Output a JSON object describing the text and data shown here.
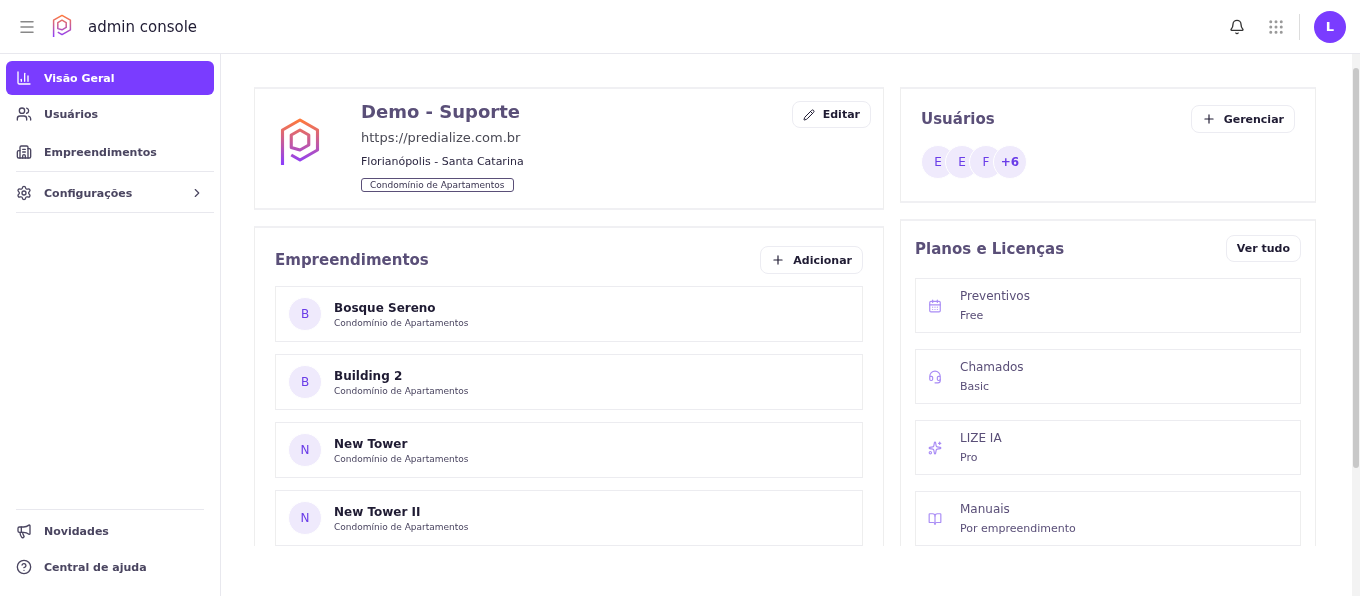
{
  "header": {
    "title": "admin console",
    "avatar": "L"
  },
  "sidebar": {
    "items": [
      {
        "label": "Visão Geral",
        "selected": true
      },
      {
        "label": "Usuários",
        "selected": false
      },
      {
        "label": "Empreendimentos",
        "selected": false
      },
      {
        "label": "Configurações",
        "selected": false,
        "kind": "expandable"
      }
    ],
    "footer": [
      {
        "label": "Novidades"
      },
      {
        "label": "Central de ajuda"
      }
    ]
  },
  "profile": {
    "name": "Demo - Suporte",
    "url": "https://predialize.com.br",
    "location": "Florianópolis - Santa Catarina",
    "tag": "Condomínio de Apartamentos",
    "button": "Editar"
  },
  "developments": {
    "title": "Empreendimentos",
    "button": "Adicionar",
    "rows": [
      {
        "initial": "B",
        "name": "Bosque Sereno",
        "type": "Condomínio de Apartamentos"
      },
      {
        "initial": "B",
        "name": "Building 2",
        "type": "Condomínio de Apartamentos"
      },
      {
        "initial": "N",
        "name": "New Tower",
        "type": "Condomínio de Apartamentos"
      },
      {
        "initial": "N",
        "name": "New Tower II",
        "type": "Condomínio de Apartamentos"
      }
    ]
  },
  "users": {
    "title": "Usuários",
    "button": "Gerenciar",
    "avatars": [
      "E",
      "E",
      "F",
      "+6"
    ]
  },
  "plans": {
    "title": "Planos e Licenças",
    "button": "Ver tudo",
    "rows": [
      {
        "name": "Preventivos",
        "tier": "Free"
      },
      {
        "name": "Chamados",
        "tier": "Basic"
      },
      {
        "name": "LIZE IA",
        "tier": "Pro"
      },
      {
        "name": "Manuais",
        "tier": "Por empreendimento"
      }
    ]
  }
}
